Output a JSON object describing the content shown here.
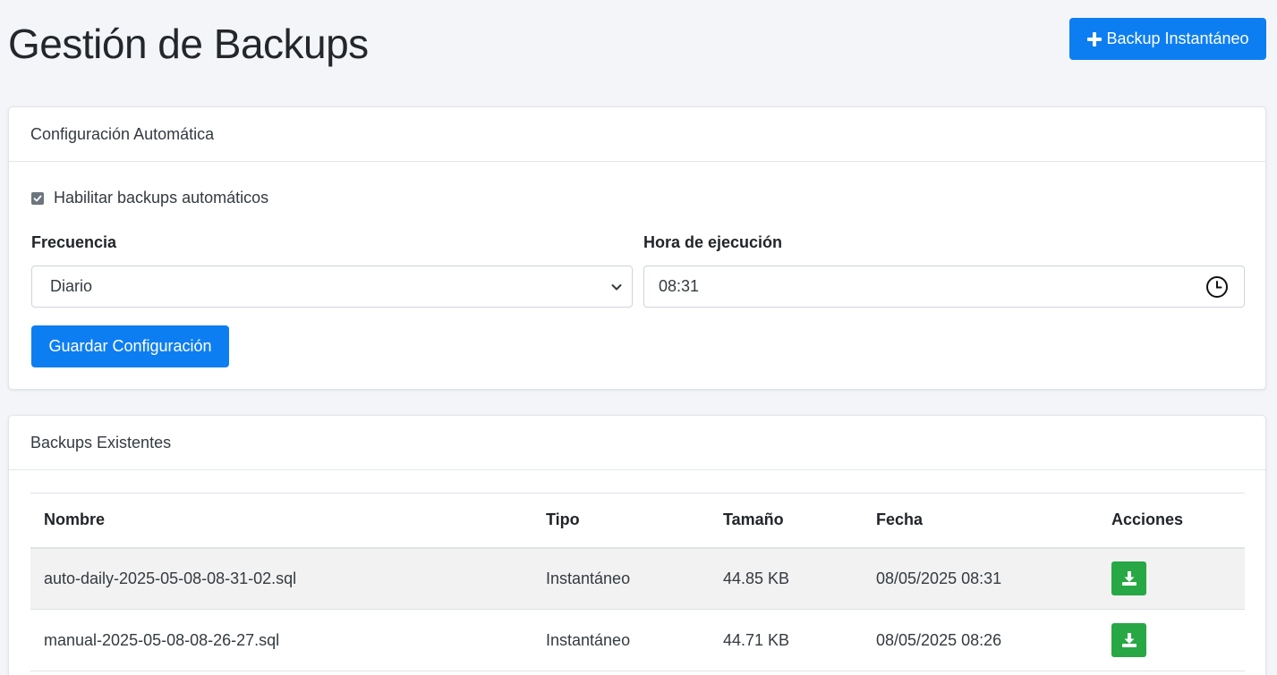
{
  "header": {
    "title": "Gestión de Backups",
    "instant_button_label": "Backup Instantáneo"
  },
  "config": {
    "card_title": "Configuración Automática",
    "enable_label": "Habilitar backups automáticos",
    "enable_checked": true,
    "frequency_label": "Frecuencia",
    "frequency_value": "Diario",
    "time_label": "Hora de ejecución",
    "time_value": "08:31",
    "save_button_label": "Guardar Configuración"
  },
  "backups": {
    "card_title": "Backups Existentes",
    "columns": [
      "Nombre",
      "Tipo",
      "Tamaño",
      "Fecha",
      "Acciones"
    ],
    "rows": [
      {
        "nombre": "auto-daily-2025-05-08-08-31-02.sql",
        "tipo": "Instantáneo",
        "tamano": "44.85 KB",
        "fecha": "08/05/2025 08:31"
      },
      {
        "nombre": "manual-2025-05-08-08-26-27.sql",
        "tipo": "Instantáneo",
        "tamano": "44.71 KB",
        "fecha": "08/05/2025 08:26"
      }
    ]
  },
  "colors": {
    "primary": "#0d7ef2",
    "success": "#28a745",
    "background": "#f4f5f9"
  },
  "icons": {
    "instant_button": "plus-icon",
    "time_input": "clock-icon",
    "select": "chevron-down-icon",
    "row_action": "download-icon"
  }
}
